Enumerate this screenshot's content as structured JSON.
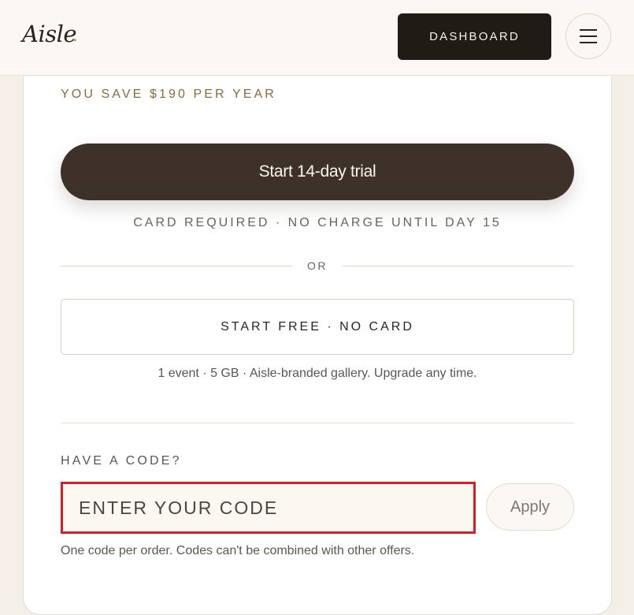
{
  "header": {
    "logo": "Aisle",
    "logo_dot": ".",
    "dashboard_label": "DASHBOARD",
    "menu_icon": "hamburger-menu-icon"
  },
  "pricing": {
    "savings": "YOU SAVE $190 PER YEAR",
    "trial_button": "Start 14-day trial",
    "trial_note": "CARD REQUIRED · NO CHARGE UNTIL DAY 15",
    "or_label": "OR",
    "free_button": "START FREE · NO CARD",
    "free_note": "1 event · 5 GB · Aisle-branded gallery. Upgrade any time."
  },
  "promo": {
    "label": "HAVE A CODE?",
    "input_placeholder": "ENTER YOUR CODE",
    "input_value": "",
    "apply_label": "Apply",
    "note": "One code per order. Codes can't be combined with other offers."
  },
  "colors": {
    "accent_gold": "#c09a5b",
    "primary_dark": "#3e3129",
    "dashboard_bg": "#211b16",
    "focus_outline": "#dd1c24",
    "page_bg": "#f4f0e8"
  }
}
